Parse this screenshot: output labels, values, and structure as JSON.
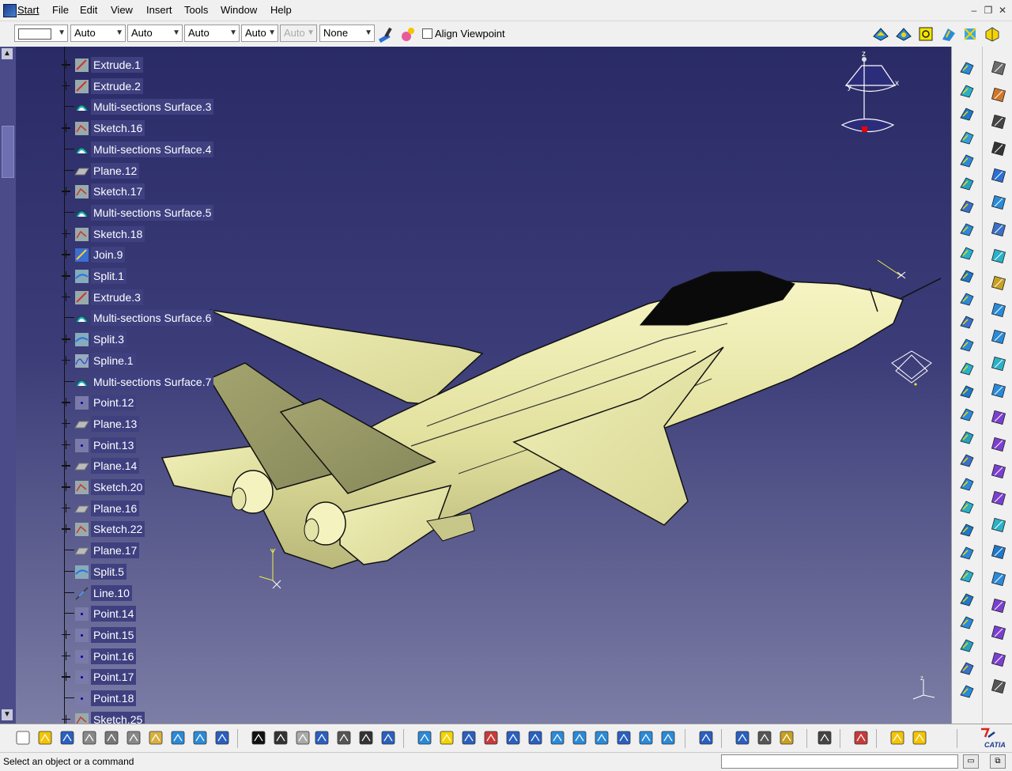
{
  "menubar": {
    "start": "Start",
    "items": [
      "File",
      "Edit",
      "View",
      "Insert",
      "Tools",
      "Window",
      "Help"
    ]
  },
  "properties_bar": {
    "color_value": "",
    "linetype_value": "Auto",
    "thickness_value": "Auto",
    "weight_value": "Auto",
    "layer_value": "Auto",
    "disabled_value": "Auto",
    "none_value": "None",
    "align_viewpoint_label": "Align Viewpoint"
  },
  "tree": {
    "items": [
      {
        "label": "Extrude.1",
        "icon": "extrude-icon",
        "expand": true
      },
      {
        "label": "Extrude.2",
        "icon": "extrude-icon",
        "expand": true
      },
      {
        "label": "Multi-sections Surface.3",
        "icon": "multi-sections-surface-icon",
        "expand": false
      },
      {
        "label": "Sketch.16",
        "icon": "sketch-icon",
        "expand": true
      },
      {
        "label": "Multi-sections Surface.4",
        "icon": "multi-sections-surface-icon",
        "expand": false
      },
      {
        "label": "Plane.12",
        "icon": "plane-icon",
        "expand": false
      },
      {
        "label": "Sketch.17",
        "icon": "sketch-icon",
        "expand": true
      },
      {
        "label": "Multi-sections Surface.5",
        "icon": "multi-sections-surface-icon",
        "expand": false
      },
      {
        "label": "Sketch.18",
        "icon": "sketch-icon",
        "expand": true
      },
      {
        "label": "Join.9",
        "icon": "join-icon",
        "expand": true
      },
      {
        "label": "Split.1",
        "icon": "split-icon",
        "expand": true
      },
      {
        "label": "Extrude.3",
        "icon": "extrude-icon",
        "expand": true
      },
      {
        "label": "Multi-sections Surface.6",
        "icon": "multi-sections-surface-icon",
        "expand": false
      },
      {
        "label": "Split.3",
        "icon": "split-icon",
        "expand": true
      },
      {
        "label": "Spline.1",
        "icon": "spline-icon",
        "expand": true
      },
      {
        "label": "Multi-sections Surface.7",
        "icon": "multi-sections-surface-icon",
        "expand": false
      },
      {
        "label": "Point.12",
        "icon": "point-icon",
        "expand": true
      },
      {
        "label": "Plane.13",
        "icon": "plane-icon",
        "expand": true
      },
      {
        "label": "Point.13",
        "icon": "point-icon",
        "expand": true
      },
      {
        "label": "Plane.14",
        "icon": "plane-icon",
        "expand": true
      },
      {
        "label": "Sketch.20",
        "icon": "sketch-icon",
        "expand": true
      },
      {
        "label": "Plane.16",
        "icon": "plane-icon",
        "expand": true
      },
      {
        "label": "Sketch.22",
        "icon": "sketch-icon",
        "expand": true
      },
      {
        "label": "Plane.17",
        "icon": "plane-icon",
        "expand": false
      },
      {
        "label": "Split.5",
        "icon": "split-icon",
        "expand": false
      },
      {
        "label": "Line.10",
        "icon": "line-icon",
        "expand": false
      },
      {
        "label": "Point.14",
        "icon": "point-icon",
        "expand": false
      },
      {
        "label": "Point.15",
        "icon": "point-icon",
        "expand": true
      },
      {
        "label": "Point.16",
        "icon": "point-icon",
        "expand": true
      },
      {
        "label": "Point.17",
        "icon": "point-icon",
        "expand": true
      },
      {
        "label": "Point.18",
        "icon": "point-icon",
        "expand": false
      },
      {
        "label": "Sketch.25",
        "icon": "sketch-icon",
        "expand": true
      }
    ]
  },
  "compass": {
    "z": "z",
    "x": "x",
    "y": "y"
  },
  "status": {
    "message": "Select an object or a command"
  },
  "brand": {
    "logo_text": "CATIA"
  },
  "colors": {
    "viewport_top": "#2a2b66",
    "viewport_bottom": "#7d7ea6",
    "model_fill": "#e8e7a8",
    "tree_label_bg": "#3f4080"
  }
}
